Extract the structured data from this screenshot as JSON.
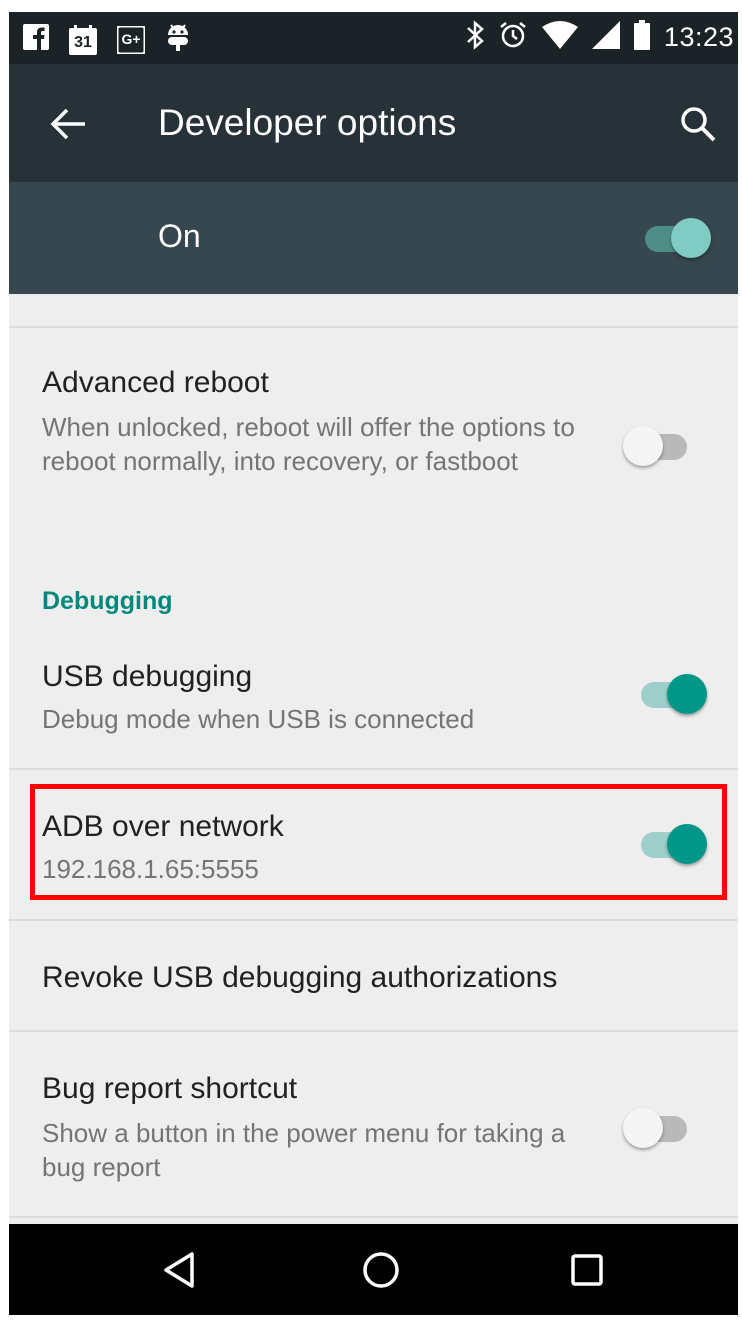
{
  "status_bar": {
    "icons_left": [
      "facebook-icon",
      "calendar-icon",
      "google-plus-icon",
      "android-debug-icon"
    ],
    "calendar_day": "31",
    "google_plus_label": "G+",
    "icons_right": [
      "bluetooth-icon",
      "alarm-icon",
      "wifi-icon",
      "signal-icon",
      "battery-icon"
    ],
    "time": "13:23"
  },
  "app_bar": {
    "title": "Developer options",
    "back_icon": "arrow-left-icon",
    "search_icon": "search-icon"
  },
  "master_switch": {
    "label": "On",
    "checked": true
  },
  "preferences": [
    {
      "title": "Advanced reboot",
      "summary": "When unlocked, reboot will offer the options to reboot normally, into recovery, or fastboot",
      "checked": false
    },
    {
      "category": "Debugging"
    },
    {
      "title": "USB debugging",
      "summary": "Debug mode when USB is connected",
      "checked": true
    },
    {
      "title": "ADB over network",
      "summary": "192.168.1.65:5555",
      "checked": true,
      "highlighted": true
    },
    {
      "title": "Revoke USB debugging authorizations"
    },
    {
      "title": "Bug report shortcut",
      "summary": "Show a button in the power menu for taking a bug report",
      "checked": false
    }
  ],
  "nav_bar": {
    "icons": [
      "back-triangle-icon",
      "home-circle-icon",
      "recents-square-icon"
    ]
  },
  "colors": {
    "status_bar": "#1c2327",
    "app_bar": "#263238",
    "master_bar": "#37474f",
    "accent": "#009688",
    "category_text": "#00897b",
    "highlight": "#ff0000",
    "background": "#eeeeee"
  }
}
